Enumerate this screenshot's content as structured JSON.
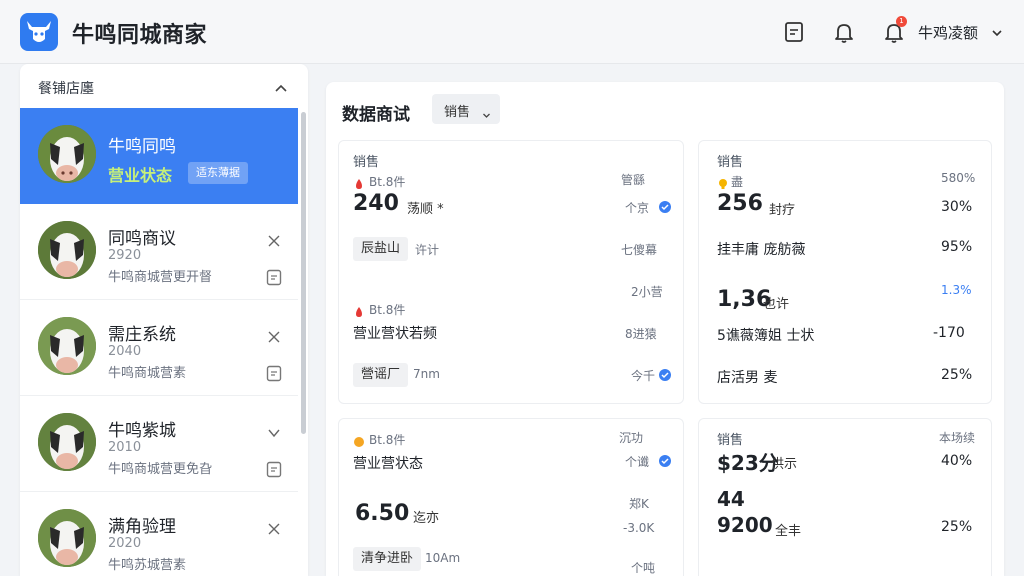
{
  "header": {
    "app_title": "牛鸣同城商家",
    "user_name": "牛鸡凌额",
    "notification_count": "1"
  },
  "sidebar": {
    "title": "餐铺店廛",
    "stores": [
      {
        "name": "牛鸣同鸣",
        "status": "营业状态",
        "status_pill": "适东薄据"
      },
      {
        "name": "同鸣商议",
        "count": "2920",
        "desc": "牛鸣商城营更开督"
      },
      {
        "name": "需庄系统",
        "count": "2040",
        "desc": "牛鸣商城营素"
      },
      {
        "name": "牛鸣紫城",
        "count": "2010",
        "desc": "牛鸣商城营更免旮"
      },
      {
        "name": "满角验理",
        "count": "2020",
        "desc": "牛鸣苏城营素"
      }
    ]
  },
  "main": {
    "title": "数据商试",
    "filter_label": "销售",
    "cards": {
      "c1": {
        "header": "销售",
        "r1_label": "Bt.8件",
        "r1_right": "管繇",
        "big_value": "240",
        "big_unit": "荡顺 *",
        "big_right": "个京",
        "chip1": "辰盐山",
        "chip1_side": "许计",
        "r3_right": "七傻幕",
        "r4_right": "2小营",
        "r5_label": "Bt.8件",
        "r6_label": "营业营状若频",
        "r6_right": "8进猿",
        "chip2": "營谣厂",
        "chip2_side": "7nm",
        "r7_right": "今千"
      },
      "c2": {
        "header": "销售",
        "r1_label": "盡",
        "r1_right": "580%",
        "big_value": "256",
        "big_unit": "封疗",
        "big_right": "30%",
        "r3_label": "挂丰庸 庞舫薇",
        "r3_right": "95%",
        "r4_value": "1,36",
        "r4_unit": "也许",
        "r4_right": "1.3%",
        "r5_label": "5谯薇簿姐 士状",
        "r5_right": "-170",
        "r6_label": "店活男 麦",
        "r6_right": "25%"
      },
      "c3": {
        "header": "Bt.8件",
        "header_right": "沉功",
        "r2_label": "营业营状态",
        "r2_right": "个谶",
        "r3_right": "郑K",
        "big_value": "6.50",
        "big_unit": "迄亦",
        "r4_right": "-3.0K",
        "chip": "清争进卧",
        "chip_side": "10Am",
        "r5_right": "个吨"
      },
      "c4": {
        "header": "销售",
        "header_right": "本场续",
        "r2_value": "$23分",
        "r2_unit": "供示",
        "r2_right": "40%",
        "r3_value": "44",
        "big_value": "9200",
        "big_unit": "全丰",
        "big_right": "25%"
      }
    }
  }
}
